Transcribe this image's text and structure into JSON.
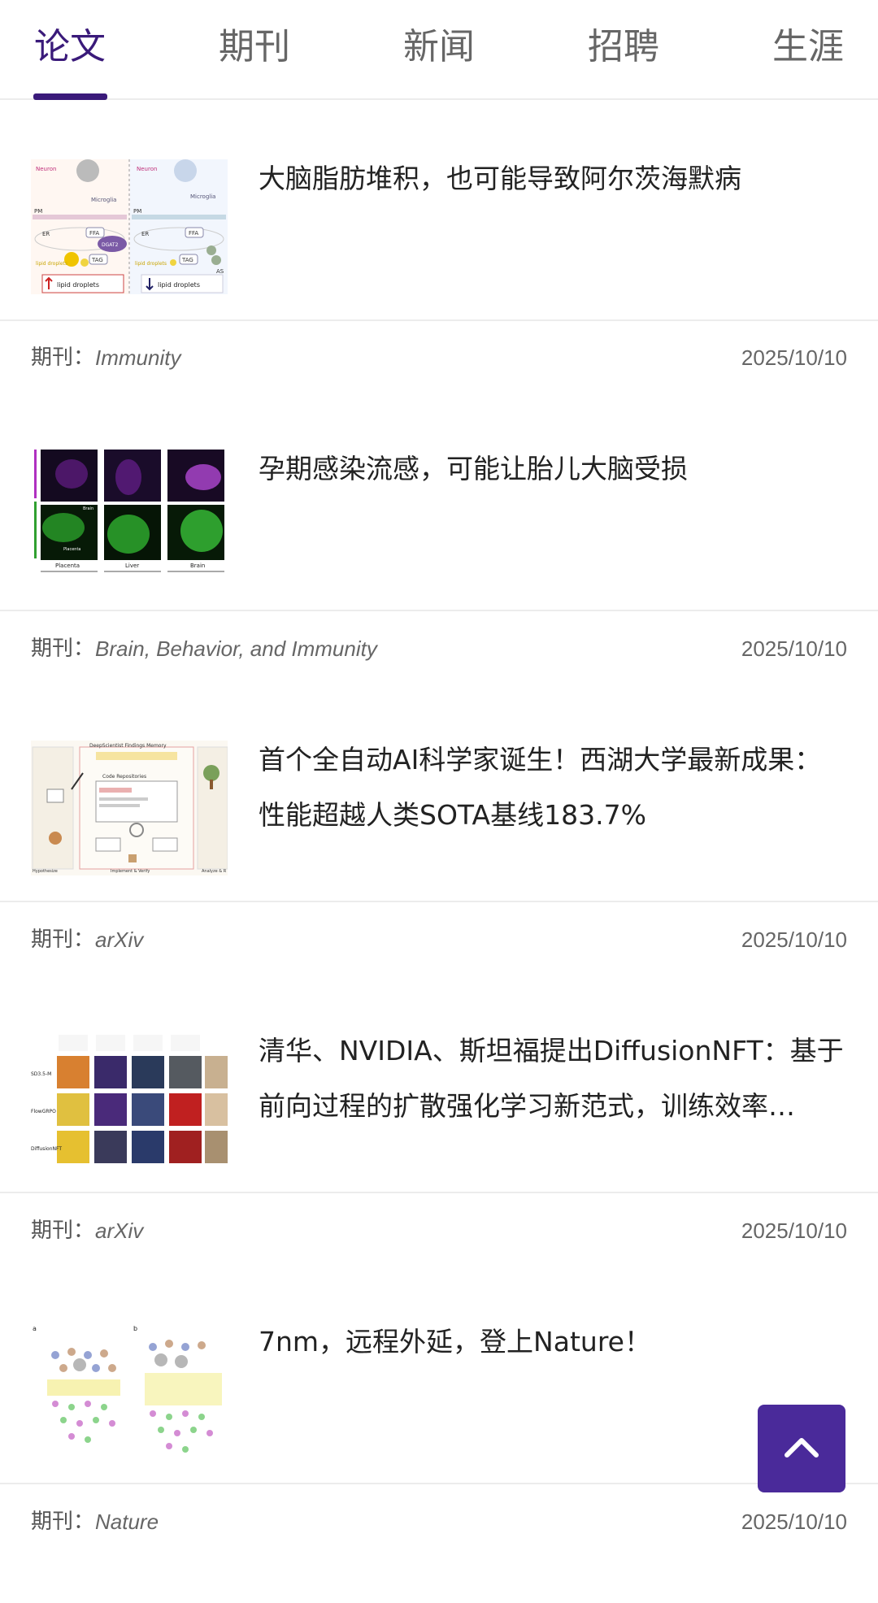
{
  "tabs": [
    {
      "label": "论文",
      "active": true
    },
    {
      "label": "期刊",
      "active": false
    },
    {
      "label": "新闻",
      "active": false
    },
    {
      "label": "招聘",
      "active": false
    },
    {
      "label": "生涯",
      "active": false
    }
  ],
  "articles": [
    {
      "title": "大脑脂肪堆积，也可能导致阿尔茨海默病",
      "journal_label": "期刊：",
      "journal": "Immunity",
      "date": "2025/10/10",
      "thumb_text": [
        "Neuron",
        "Microglia",
        "Neuron",
        "Microglia",
        "PM",
        "PM",
        "ER",
        "FFA",
        "ER",
        "FFA",
        "DGAT2",
        "lipid droplets",
        "TAG",
        "lipid droplets",
        "TAG",
        "lipid droplets",
        "lipid droplets",
        "AS"
      ]
    },
    {
      "title": "孕期感染流感，可能让胎儿大脑受损",
      "journal_label": "期刊：",
      "journal": "Brain, Behavior, and Immunity",
      "date": "2025/10/10",
      "thumb_text": [
        "Placenta",
        "Liver",
        "Brain",
        "Brain",
        "Placenta",
        "Liver"
      ]
    },
    {
      "title": "首个全自动AI科学家诞生！西湖大学最新成果：性能超越人类SOTA基线183.7%",
      "journal_label": "期刊：",
      "journal": "arXiv",
      "date": "2025/10/10",
      "thumb_text": [
        "DeepScientist Findings Memory",
        "Code Repositories",
        "Implement & Verify",
        "Analyze & R",
        "Hypothesize"
      ]
    },
    {
      "title": "清华、NVIDIA、斯坦福提出DiffusionNFT：基于前向过程的扩散强化学习新范式，训练效率…",
      "journal_label": "期刊：",
      "journal": "arXiv",
      "date": "2025/10/10",
      "thumb_text": [
        "SD3.5-M",
        "FlowGRPO",
        "DiffusionNFT"
      ]
    },
    {
      "title": "7nm，远程外延，登上Nature！",
      "journal_label": "期刊：",
      "journal": "Nature",
      "date": "2025/10/10",
      "thumb_text": [
        "a",
        "b"
      ]
    }
  ],
  "colors": {
    "accent": "#3a1a7a",
    "back_to_top": "#4a2a9a"
  },
  "icons": {
    "back_to_top": "chevron-up-icon"
  }
}
